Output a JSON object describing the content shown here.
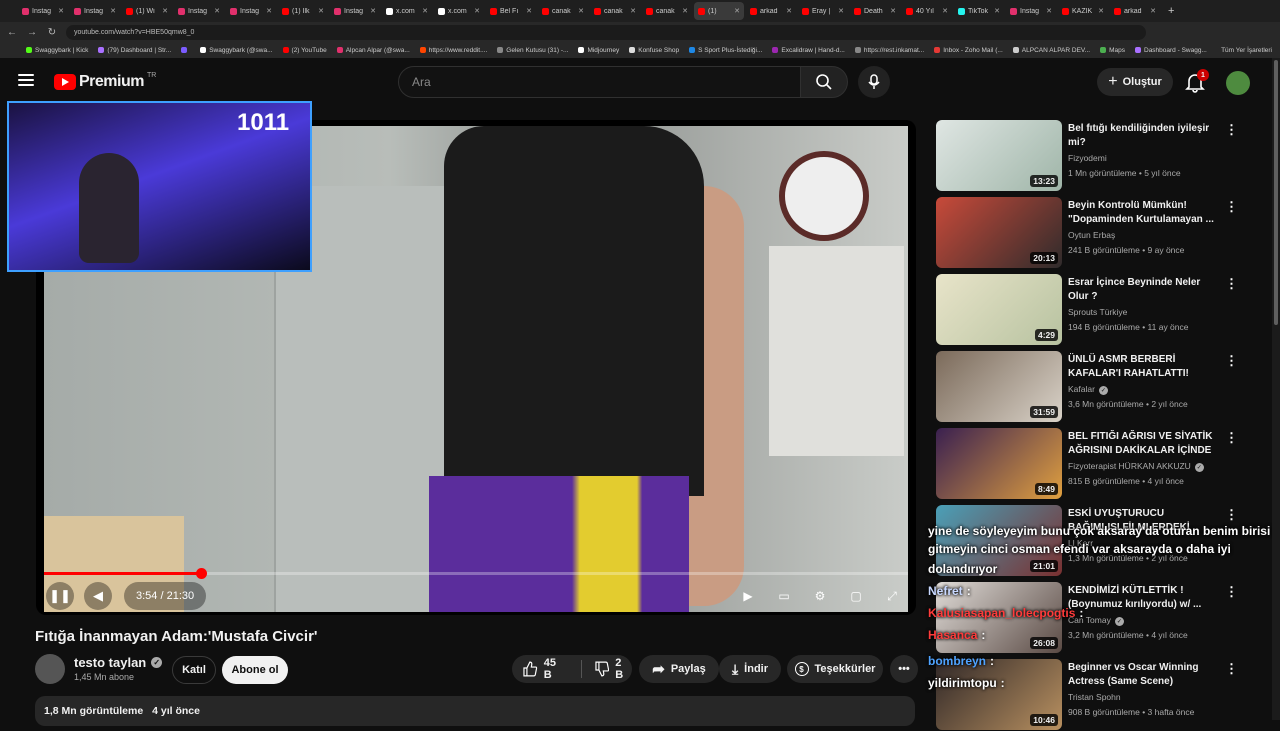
{
  "browser": {
    "tabs": [
      "Instag",
      "Instag",
      "(1) Wi",
      "Instag",
      "Instag",
      "(1) İlk",
      "Instag",
      "x.com",
      "x.com",
      "Bel Fı",
      "canak",
      "canak",
      "canak",
      "(1)",
      "arkad",
      "Eray |",
      "Death",
      "40 Yıl",
      "TikTok",
      "Instag",
      "KAZIK",
      "arkad"
    ],
    "url": "youtube.com/watch?v=HBE50qmw8_0",
    "bookmarks": [
      "Swaggybark | Kick",
      "(79) Dashboard | Str...",
      "",
      "Swaggybark (@swa...",
      "(2) YouTube",
      "Alpcan Alpar (@swa...",
      "https://www.reddit....",
      "Gelen Kutusu (31) -...",
      "Midjourney",
      "Konfuse Shop",
      "S Sport Plus-İstediği...",
      "Excalidraw | Hand-d...",
      "https://rest.inkamat...",
      "Inbox - Zoho Mail (...",
      "ALPCAN ALPAR DEV...",
      "Maps",
      "Dashboard - Swagg..."
    ],
    "bookmarks_right": "Tüm Yer İşaretleri"
  },
  "header": {
    "logo": "Premium",
    "region": "TR",
    "search_placeholder": "Ara",
    "create_label": "Oluştur",
    "notification_count": "1"
  },
  "overlay": {
    "counter": "1011"
  },
  "player": {
    "current_time": "3:54",
    "duration": "21:30",
    "time_display": "3:54 / 21:30",
    "progress": 0.182
  },
  "video": {
    "title": "Fıtığa İnanmayan Adam:'Mustafa Civcir'",
    "channel": "testo taylan",
    "subscribers": "1,45 Mn abone",
    "join_label": "Katıl",
    "subscribe_label": "Abone ol",
    "likes": "45 B",
    "dislikes": "2 B",
    "share_label": "Paylaş",
    "download_label": "İndir",
    "thanks_label": "Teşekkürler",
    "views": "1,8 Mn görüntüleme",
    "age": "4 yıl önce"
  },
  "recommended": [
    {
      "title": "Bel fıtığı kendiliğinden iyileşir mi?",
      "channel": "Fizyodemi",
      "views": "1 Mn görüntüleme",
      "age": "5 yıl önce",
      "duration": "13:23",
      "verified": false
    },
    {
      "title": "Beyin Kontrolü Mümkün! \"Dopaminden Kurtulamayan ...",
      "channel": "Oytun Erbaş",
      "views": "241 B görüntüleme",
      "age": "9 ay önce",
      "duration": "20:13",
      "verified": false
    },
    {
      "title": "Esrar İçince Beyninde Neler Olur ?",
      "channel": "Sprouts Türkiye",
      "views": "194 B görüntüleme",
      "age": "11 ay önce",
      "duration": "4:29",
      "verified": false
    },
    {
      "title": "ÜNLÜ ASMR BERBERİ KAFALAR'I RAHATLATTI!",
      "channel": "Kafalar",
      "views": "3,6 Mn görüntüleme",
      "age": "2 yıl önce",
      "duration": "31:59",
      "verified": true
    },
    {
      "title": "BEL FITIĞI AĞRISI VE SİYATİK AĞRISINI DAKİKALAR İÇİNDE ...",
      "channel": "Fizyoterapist HÜRKAN AKKUZU",
      "views": "815 B görüntüleme",
      "age": "4 yıl önce",
      "duration": "8:49",
      "verified": true
    },
    {
      "title": "ESKİ UYUŞTURUCU BAĞIMLISI FİLMLERDEKİ UYUŞTURUCU...",
      "channel": "Ll Kerr",
      "views": "1,3 Mn görüntüleme",
      "age": "2 yıl önce",
      "duration": "21:01",
      "verified": false
    },
    {
      "title": "KENDİMİZİ KÜTLETTİK ! (Boynumuz kırılıyordu) w/ ...",
      "channel": "Can Tomay",
      "views": "3,2 Mn görüntüleme",
      "age": "4 yıl önce",
      "duration": "26:08",
      "verified": true
    },
    {
      "title": "Beginner vs Oscar Winning Actress (Same Scene)",
      "channel": "Tristan Spohn",
      "views": "908 B görüntüleme",
      "age": "3 hafta önce",
      "duration": "10:46",
      "verified": false
    }
  ],
  "chat": [
    {
      "user": "",
      "message": "yine de söyleyeyim bunu çok aksaray'da oturan benim birisi ona da",
      "color": "#ffffff"
    },
    {
      "user": "",
      "message": "gitmeyin cinci osman efendi var aksarayda o daha iyi",
      "color": "#ffffff"
    },
    {
      "user": "",
      "message": "dolandırıyor",
      "color": "#ffffff"
    },
    {
      "user": "Nefret",
      "message": ":",
      "color": "#c8d8ff"
    },
    {
      "user": "Kalusiasapan_lolecpogtis",
      "message": ":",
      "color": "#ff3b3b"
    },
    {
      "user": "Hasanca",
      "message": ":",
      "color": "#ff3b3b"
    },
    {
      "user": "bombreyn",
      "message": ":",
      "color": "#4fa3ff"
    },
    {
      "user": "yildirimtopu",
      "message": ":",
      "color": "#ffffff"
    }
  ],
  "colors": {
    "accent": "#ff0000",
    "background": "#0f0f0f",
    "webcam_border": "#3ea0ff"
  }
}
